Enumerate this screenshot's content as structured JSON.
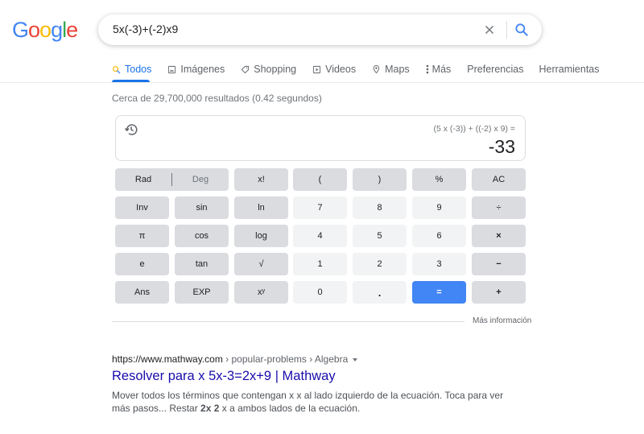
{
  "logo": {
    "letters": [
      {
        "char": "G",
        "color": "#4285f4"
      },
      {
        "char": "o",
        "color": "#ea4335"
      },
      {
        "char": "o",
        "color": "#fbbc05"
      },
      {
        "char": "g",
        "color": "#4285f4"
      },
      {
        "char": "l",
        "color": "#34a853"
      },
      {
        "char": "e",
        "color": "#ea4335"
      }
    ]
  },
  "search": {
    "query": "5x(-3)+(-2)x9",
    "clear_icon": "close-icon",
    "search_icon": "search-icon"
  },
  "tabs": [
    {
      "label": "Todos",
      "icon": "search-icon",
      "active": true
    },
    {
      "label": "Imágenes",
      "icon": "image-icon"
    },
    {
      "label": "Shopping",
      "icon": "tag-icon"
    },
    {
      "label": "Videos",
      "icon": "play-icon"
    },
    {
      "label": "Maps",
      "icon": "pin-icon"
    },
    {
      "label": "Más",
      "icon": "more-vert-icon"
    },
    {
      "label": "Preferencias"
    },
    {
      "label": "Herramientas"
    }
  ],
  "stats": "Cerca de 29,700,000 resultados (0.42 segundos)",
  "calculator": {
    "expression": "(5 x (-3)) + ((-2) x 9) =",
    "result": "-33",
    "history_icon": "history-icon",
    "mode": {
      "rad": "Rad",
      "deg": "Deg"
    },
    "keys": [
      [
        "x!",
        "(",
        ")",
        "%",
        "AC"
      ],
      [
        "Inv",
        "sin",
        "ln",
        "7",
        "8",
        "9",
        "÷"
      ],
      [
        "π",
        "cos",
        "log",
        "4",
        "5",
        "6",
        "×"
      ],
      [
        "e",
        "tan",
        "√",
        "1",
        "2",
        "3",
        "−"
      ],
      [
        "Ans",
        "EXP",
        "xʸ",
        "0",
        ".",
        "=",
        "+"
      ]
    ]
  },
  "more_info": "Más información",
  "result": {
    "url": "https://www.mathway.com",
    "crumbs": " › popular-problems › Algebra",
    "title": "Resolver para x 5x-3=2x+9 | Mathway",
    "snippet_1": "Mover todos los términos que contengan x x al lado izquierdo de la ecuación. Toca para ver más pasos... Restar ",
    "snippet_bold_1": "2x",
    "snippet_2": " ",
    "snippet_bold_2": "2",
    "snippet_3": " x a ambos lados de la ecuación."
  },
  "colors": {
    "accent": "#1a73e8",
    "link": "#1a0dab",
    "equals_key": "#4285f4"
  }
}
